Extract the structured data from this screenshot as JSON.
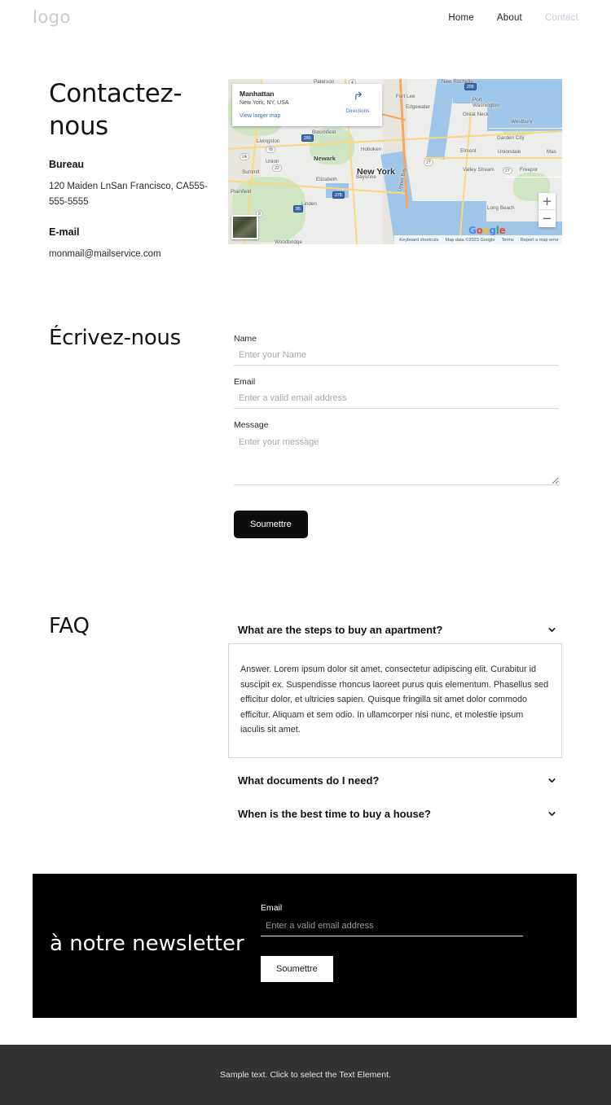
{
  "header": {
    "logo": "logo",
    "nav": [
      {
        "label": "Home",
        "current": false
      },
      {
        "label": "About",
        "current": false
      },
      {
        "label": "Contact",
        "current": true
      }
    ]
  },
  "contact": {
    "title": "Contactez-nous",
    "office_label": "Bureau",
    "address": "120 Maiden LnSan Francisco, CA555-555-5555",
    "email_label": "E-mail",
    "email": "monmail@mailservice.com"
  },
  "map": {
    "card_title": "Manhattan",
    "card_subtitle": "New York, NY, USA",
    "directions_label": "Directions",
    "view_larger_label": "View larger map",
    "zoom_in": "+",
    "zoom_out": "−",
    "watermark": "Google",
    "footer": [
      "Keyboard shortcuts",
      "Map data ©2023 Google",
      "Terms",
      "Report a map error"
    ],
    "labels": [
      "New York",
      "Newark",
      "Paterson",
      "New Rochelle",
      "Fort Lee",
      "Port Washington",
      "Great Neck",
      "Westbury",
      "Garden City",
      "Uniondale",
      "Elmont",
      "Valley Stream",
      "Freeport",
      "Long Beach",
      "Hoboken",
      "Bloomfield",
      "Livingston",
      "Summit",
      "Elizabeth",
      "Bayonne",
      "Linden",
      "Plainfield",
      "Union",
      "Woodbridge",
      "Edgewater",
      "Upper Bay",
      "Mas"
    ]
  },
  "write_us": {
    "title": "Écrivez-nous",
    "fields": [
      {
        "label": "Name",
        "placeholder": "Enter your Name",
        "value": ""
      },
      {
        "label": "Email",
        "placeholder": "Enter a valid email address",
        "value": ""
      },
      {
        "label": "Message",
        "placeholder": "Enter your message",
        "value": ""
      }
    ],
    "submit_label": "Soumettre"
  },
  "faq": {
    "title": "FAQ",
    "items": [
      {
        "question": "What are the steps to buy an apartment?",
        "expanded": true,
        "answer": "Answer. Lorem ipsum dolor sit amet, consectetur adipiscing elit. Curabitur id suscipit ex. Suspendisse rhoncus laoreet purus quis elementum. Phasellus sed efficitur dolor, et ultricies sapien. Quisque fringilla sit amet dolor commodo efficitur. Aliquam et sem odio. In ullamcorper nisi nunc, et molestie ipsum iaculis sit amet."
      },
      {
        "question": "What documents do I need?",
        "expanded": false,
        "answer": ""
      },
      {
        "question": "When is the best time to buy a house?",
        "expanded": false,
        "answer": ""
      }
    ]
  },
  "newsletter": {
    "title": "à notre newsletter",
    "email_label": "Email",
    "email_placeholder": "Enter a valid email address",
    "email_value": "",
    "submit_label": "Soumettre"
  },
  "footer": {
    "text": "Sample text. Click to select the Text Element."
  },
  "colors": {
    "accent_dark": "#000000",
    "footer_bg": "#333333",
    "nav_active": "#c3ccd6",
    "map_link": "#3a6fc4"
  }
}
